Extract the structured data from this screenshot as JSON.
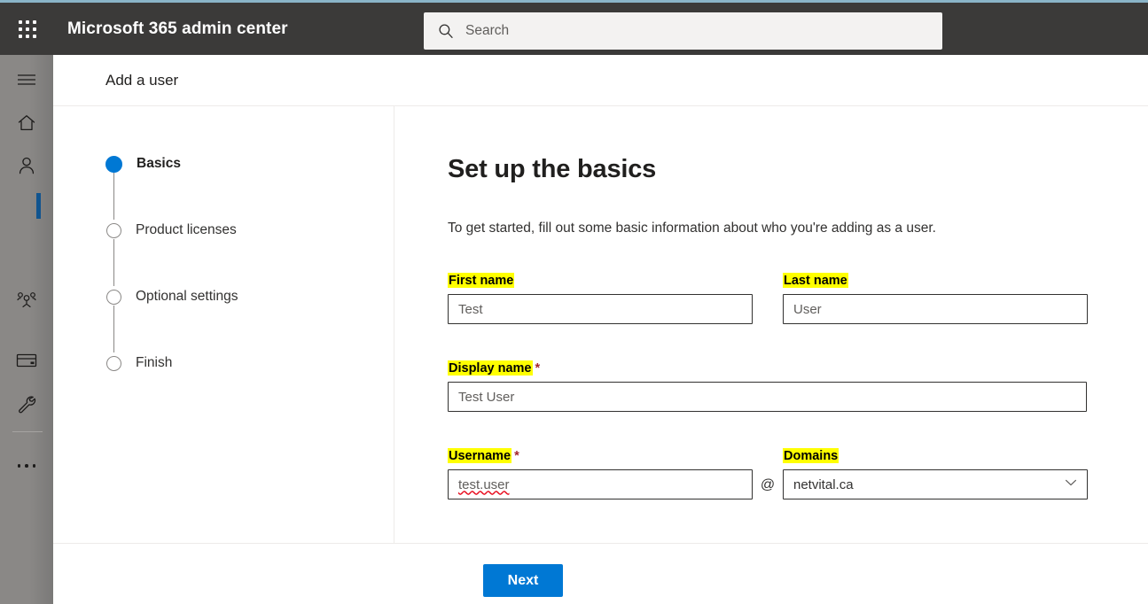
{
  "header": {
    "waffle_label": "app-launcher",
    "suite_title": "Microsoft 365 admin center",
    "search_placeholder": "Search",
    "background_color": "#3b3a39"
  },
  "rail": {
    "items": [
      {
        "icon": "hamburger-menu-icon",
        "name": "nav-toggle"
      },
      {
        "icon": "home-icon",
        "name": "home"
      },
      {
        "icon": "person-icon",
        "name": "users"
      },
      {
        "icon": "people-group-icon",
        "name": "teams-groups"
      },
      {
        "icon": "credit-card-icon",
        "name": "billing"
      },
      {
        "icon": "wrench-icon",
        "name": "support"
      },
      {
        "icon": "ellipsis-icon",
        "name": "show-all"
      }
    ],
    "active_indicator_color": "#10548f"
  },
  "panel": {
    "title": "Add a user"
  },
  "wizard": {
    "steps": [
      {
        "label": "Basics",
        "state": "active"
      },
      {
        "label": "Product licenses",
        "state": "pending"
      },
      {
        "label": "Optional settings",
        "state": "pending"
      },
      {
        "label": "Finish",
        "state": "pending"
      }
    ],
    "active_color": "#0078d4"
  },
  "form": {
    "heading": "Set up the basics",
    "subtitle": "To get started, fill out some basic information about who you're adding as a user.",
    "highlight_color": "#ffff00",
    "required_marker": "*",
    "fields": {
      "first_name": {
        "label": "First name",
        "value": "Test",
        "required": false
      },
      "last_name": {
        "label": "Last name",
        "value": "User",
        "required": false
      },
      "display_name": {
        "label": "Display name",
        "value": "Test User",
        "required": true
      },
      "username": {
        "label": "Username",
        "value": "test.user",
        "required": true
      },
      "at_separator": "@",
      "domains": {
        "label": "Domains",
        "value": "netvital.ca",
        "required": false
      }
    }
  },
  "footer": {
    "next_label": "Next",
    "next_color": "#0078d4"
  }
}
